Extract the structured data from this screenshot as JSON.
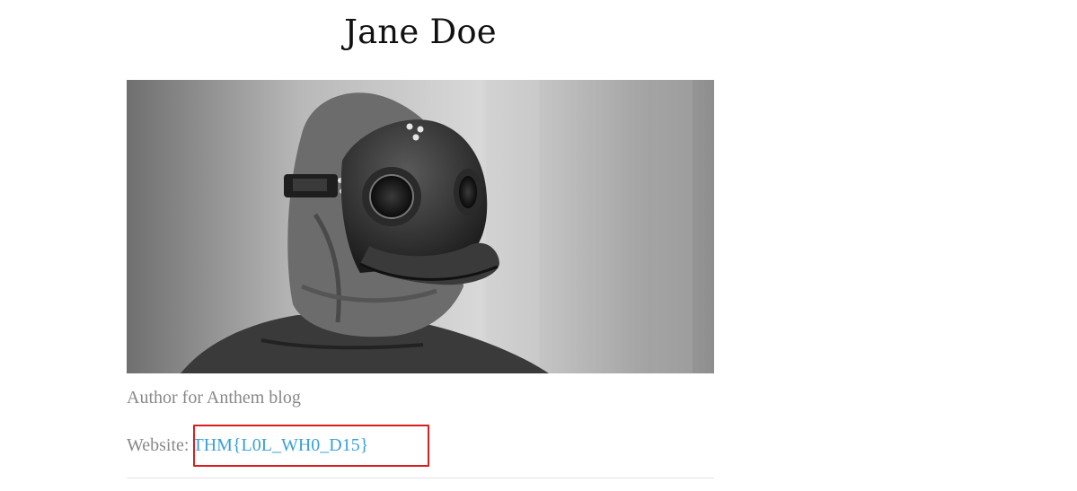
{
  "author": {
    "name": "Jane Doe",
    "bio": "Author for Anthem blog",
    "website_label": "Website:",
    "website_value": "THM{L0L_WH0_D15}"
  },
  "colors": {
    "link": "#3aa0d6",
    "highlight_border": "#d81e1e",
    "muted_text": "#888888",
    "title_text": "#111111"
  },
  "image": {
    "subject": "person-in-plague-doctor-mask-photo",
    "style": "black-and-white"
  }
}
